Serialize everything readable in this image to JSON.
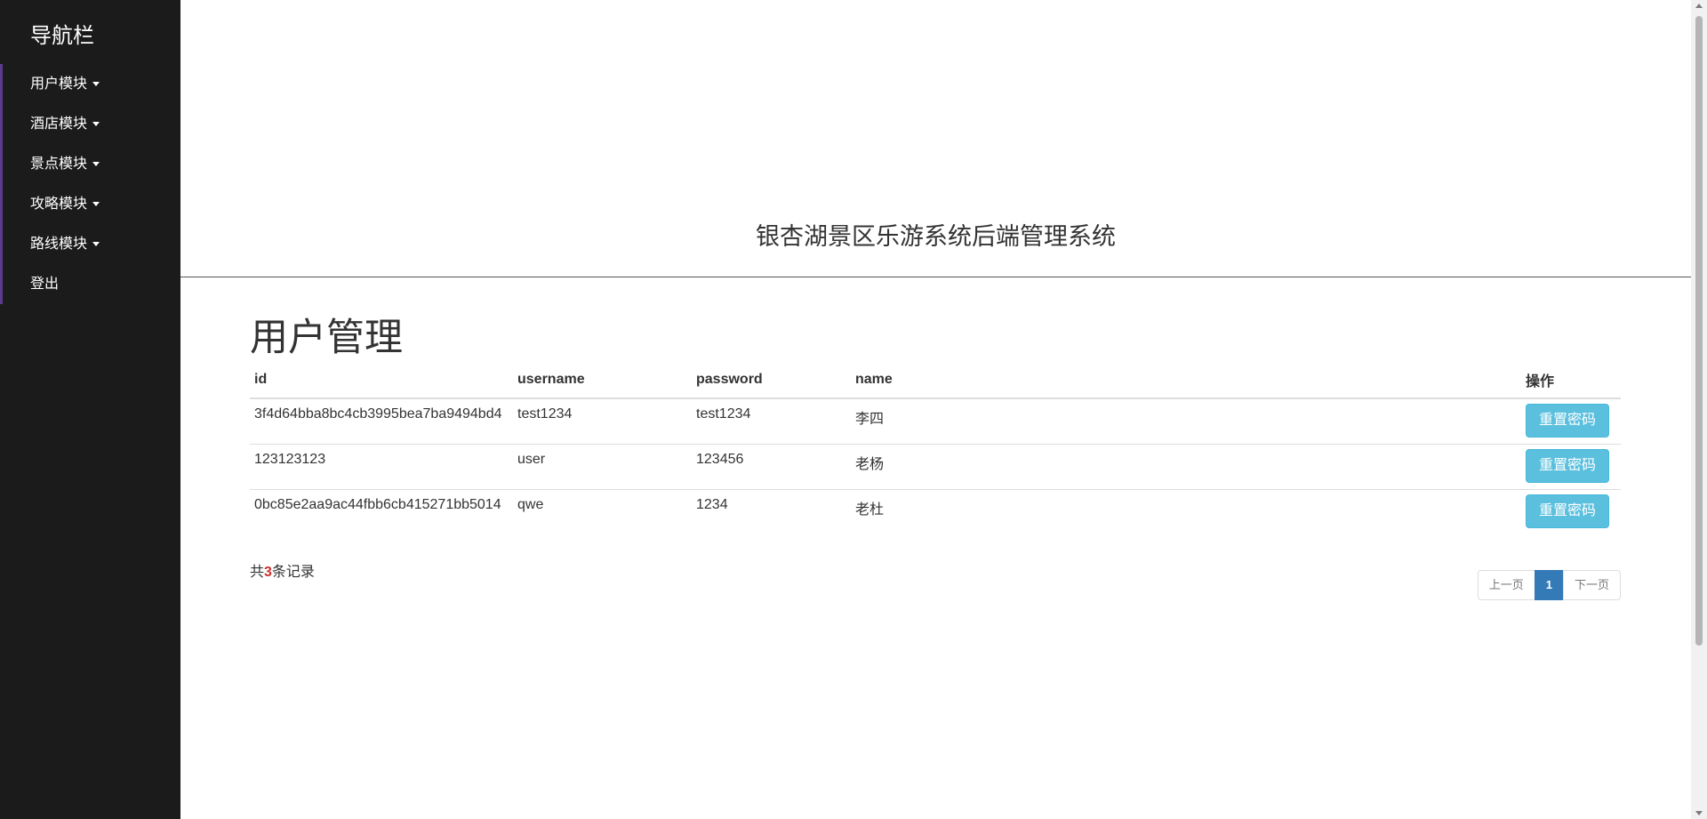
{
  "sidebar": {
    "title": "导航栏",
    "items": [
      {
        "label": "用户模块",
        "dropdown": true
      },
      {
        "label": "酒店模块",
        "dropdown": true
      },
      {
        "label": "景点模块",
        "dropdown": true
      },
      {
        "label": "攻略模块",
        "dropdown": true
      },
      {
        "label": "路线模块",
        "dropdown": true
      },
      {
        "label": "登出",
        "dropdown": false
      }
    ]
  },
  "header": {
    "title": "银杏湖景区乐游系统后端管理系统"
  },
  "main": {
    "page_title": "用户管理",
    "table": {
      "columns": [
        "id",
        "username",
        "password",
        "name",
        "操作"
      ],
      "rows": [
        {
          "id": "3f4d64bba8bc4cb3995bea7ba9494bd4",
          "username": "test1234",
          "password": "test1234",
          "name": "李四",
          "action": "重置密码"
        },
        {
          "id": "123123123",
          "username": "user",
          "password": "123456",
          "name": "老杨",
          "action": "重置密码"
        },
        {
          "id": "0bc85e2aa9ac44fbb6cb415271bb5014",
          "username": "qwe",
          "password": "1234",
          "name": "老杜",
          "action": "重置密码"
        }
      ]
    },
    "record_count": {
      "prefix": "共",
      "count": "3",
      "suffix": "条记录"
    },
    "pagination": {
      "prev": "上一页",
      "current": "1",
      "next": "下一页"
    }
  },
  "colors": {
    "sidebar_bg": "#1b1b1b",
    "sidebar_accent": "#5b3b8c",
    "button_info": "#5bc0de",
    "page_active": "#337ab7",
    "count_highlight": "#c9302c"
  }
}
